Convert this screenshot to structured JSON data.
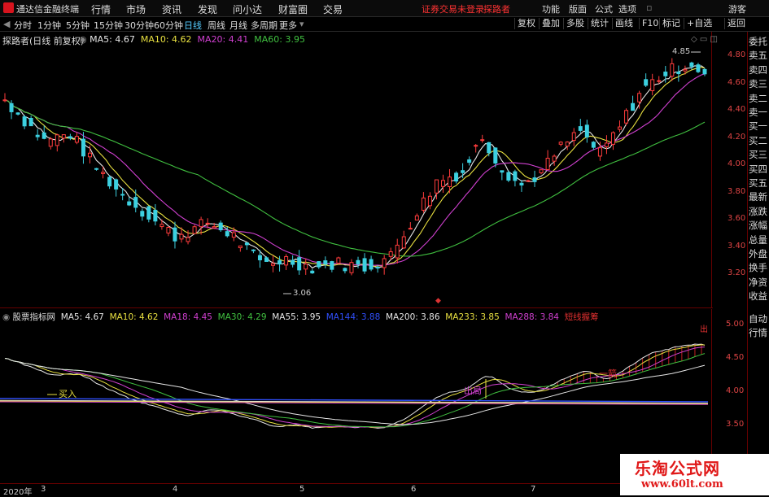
{
  "menubar": {
    "app_name": "通达信金融终端",
    "menus": [
      "行情",
      "市场",
      "资讯",
      "发现",
      "问小达",
      "财富圈",
      "交易"
    ],
    "account_status": "证券交易未登录",
    "user": "探路者",
    "right_menus": [
      "功能",
      "版面",
      "公式",
      "选项"
    ],
    "guest": "游客"
  },
  "toolbar": {
    "periods": [
      "分时",
      "1分钟",
      "5分钟",
      "15分钟",
      "30分钟",
      "60分钟",
      "日线",
      "周线",
      "月线",
      "多周期",
      "更多"
    ],
    "active": "日线",
    "right_buttons": [
      "复权",
      "叠加",
      "多股",
      "统计",
      "画线",
      "F10",
      "标记",
      "+自选",
      "返回"
    ]
  },
  "main_chart": {
    "stock_label": "探路者(日线 前复权)",
    "ma_legend": [
      {
        "text": "MA5: 4.67",
        "color": "#e6e6e6"
      },
      {
        "text": "MA10: 4.62",
        "color": "#e8e040"
      },
      {
        "text": "MA20: 4.41",
        "color": "#d040d0"
      },
      {
        "text": "MA60: 3.95",
        "color": "#40c040"
      }
    ],
    "y_ticks": [
      "4.80",
      "4.60",
      "4.40",
      "4.20",
      "4.00",
      "3.80",
      "3.60",
      "3.40",
      "3.20"
    ],
    "high_label": "4.85",
    "low_label": "3.06"
  },
  "sub_chart": {
    "title": "股票指标网",
    "legend": [
      {
        "text": "MA5: 4.67",
        "color": "#e6e6e6"
      },
      {
        "text": "MA10: 4.62",
        "color": "#e8e040"
      },
      {
        "text": "MA18: 4.45",
        "color": "#d040d0"
      },
      {
        "text": "MA30: 4.29",
        "color": "#40c040"
      },
      {
        "text": "MA55: 3.95",
        "color": "#e6e6e6"
      },
      {
        "text": "MA144: 3.88",
        "color": "#3050ff"
      },
      {
        "text": "MA200: 3.86",
        "color": "#e6e6e6"
      },
      {
        "text": "MA233: 3.85",
        "color": "#e8e040"
      },
      {
        "text": "MA288: 3.84",
        "color": "#d040d0"
      },
      {
        "text": "短线握筹",
        "color": "#e03030"
      }
    ],
    "y_ticks": [
      "5.00",
      "4.50",
      "4.00",
      "3.50"
    ],
    "annotations": {
      "buy": "买入",
      "sell": "出局",
      "yiqian": "一箭",
      "out": "出"
    }
  },
  "right_panel": [
    "委托",
    "卖五",
    "卖四",
    "卖三",
    "卖二",
    "卖一",
    "买一",
    "买二",
    "买三",
    "买四",
    "买五",
    "最新",
    "涨跌",
    "涨幅",
    "总量",
    "外盘",
    "换手",
    "净资",
    "收益",
    "自动",
    "行情"
  ],
  "x_axis": [
    "2020年",
    "3",
    "4",
    "5",
    "6",
    "7"
  ],
  "watermark": {
    "title": "乐淘公式网",
    "url": "www.60lt.com"
  }
}
